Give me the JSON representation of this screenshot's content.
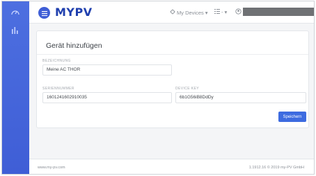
{
  "sidebar": {
    "items": [
      {
        "icon": "gauge-icon"
      },
      {
        "icon": "bar-chart-icon"
      }
    ]
  },
  "header": {
    "logo": "MYPV",
    "nav": {
      "devices_label": "My Devices",
      "list_label": "-"
    }
  },
  "form": {
    "title": "Gerät hinzufügen",
    "fields": {
      "name": {
        "label": "Bezeichnung",
        "value": "Meine AC THOR"
      },
      "serial": {
        "label": "Seriennummer",
        "value": "1601241602910035"
      },
      "device_key": {
        "label": "Device Key",
        "value": "6b1G56iB8DdDy"
      }
    },
    "save_label": "Speichern"
  },
  "footer": {
    "left": "www.my-pv.com",
    "right": "1.1912.16 © 2019 my-PV GmbH"
  },
  "colors": {
    "sidebar": "#3f5ed6",
    "primary": "#3d6be0",
    "logo": "#1f3fae"
  }
}
